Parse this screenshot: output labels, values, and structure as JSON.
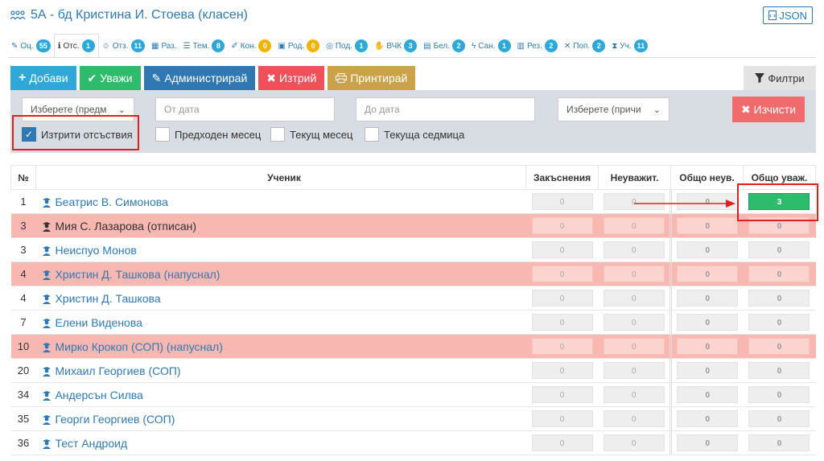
{
  "header": {
    "title": "5А - бд Кристина И. Стоева (класен)",
    "json_label": "JSON"
  },
  "tabs": [
    {
      "label": "Оц.",
      "badge": "55",
      "icon": "pencil-icon",
      "color": "#2fa8d8",
      "active": false
    },
    {
      "label": "Отс.",
      "badge": "1",
      "icon": "info-circle-icon",
      "color": "#2fa8d8",
      "active": true
    },
    {
      "label": "Отз.",
      "badge": "11",
      "icon": "users-icon",
      "color": "#2fa8d8",
      "active": false
    },
    {
      "label": "Раз.",
      "badge": "",
      "icon": "table-icon",
      "color": "#2fa8d8",
      "active": false
    },
    {
      "label": "Тем.",
      "badge": "8",
      "icon": "list-icon",
      "color": "#2fa8d8",
      "active": false
    },
    {
      "label": "Кон.",
      "badge": "0",
      "icon": "edit-icon",
      "color": "#f0b400",
      "active": false
    },
    {
      "label": "Род.",
      "badge": "0",
      "icon": "calendar-icon",
      "color": "#f0b400",
      "active": false
    },
    {
      "label": "Под.",
      "badge": "1",
      "icon": "eye-icon",
      "color": "#2fa8d8",
      "active": false
    },
    {
      "label": "ВЧК",
      "badge": "3",
      "icon": "handshake-icon",
      "color": "#2fa8d8",
      "active": false
    },
    {
      "label": "Бел.",
      "badge": "2",
      "icon": "note-icon",
      "color": "#2fa8d8",
      "active": false
    },
    {
      "label": "Сан.",
      "badge": "1",
      "icon": "bolt-icon",
      "color": "#2fa8d8",
      "active": false
    },
    {
      "label": "Рез.",
      "badge": "2",
      "icon": "doc-icon",
      "color": "#2fa8d8",
      "active": false
    },
    {
      "label": "Поп.",
      "badge": "2",
      "icon": "tools-icon",
      "color": "#2fa8d8",
      "active": false
    },
    {
      "label": "Уч.",
      "badge": "11",
      "icon": "hourglass-icon",
      "color": "#2fa8d8",
      "active": false
    }
  ],
  "actions": {
    "add": "Добави",
    "excuse": "Уважи",
    "administer": "Администрирай",
    "delete": "Изтрий",
    "print": "Принтирай",
    "filters": "Филтри"
  },
  "filters": {
    "subject_select": "Изберете (предм",
    "from_date_placeholder": "От дата",
    "to_date_placeholder": "До дата",
    "reason_select": "Изберете (причи",
    "clear": "Изчисти",
    "deleted_label": "Изтрити отсъствия",
    "prev_month_label": "Предходен месец",
    "current_month_label": "Текущ месец",
    "current_week_label": "Текуща седмица"
  },
  "table": {
    "headers": [
      "№",
      "Ученик",
      "Закъснения",
      "Неуважит.",
      "Общо неув.",
      "Общо уваж."
    ],
    "rows": [
      {
        "num": "1",
        "name": "Беатрис В. Симонова",
        "late": "0",
        "unexc": "0",
        "total_unexc": "0",
        "total_exc": "3",
        "pink": false
      },
      {
        "num": "3",
        "name": "Мия С. Лазарова (отписан)",
        "late": "0",
        "unexc": "0",
        "total_unexc": "0",
        "total_exc": "0",
        "pink": true
      },
      {
        "num": "3",
        "name": "Неиспуо Монов",
        "late": "0",
        "unexc": "0",
        "total_unexc": "0",
        "total_exc": "0",
        "pink": false
      },
      {
        "num": "4",
        "name": "Христин Д. Ташкова (напуснал)",
        "late": "0",
        "unexc": "0",
        "total_unexc": "0",
        "total_exc": "0",
        "pink": true
      },
      {
        "num": "4",
        "name": "Христин Д. Ташкова",
        "late": "0",
        "unexc": "0",
        "total_unexc": "0",
        "total_exc": "0",
        "pink": false
      },
      {
        "num": "7",
        "name": "Елени Виденова",
        "late": "0",
        "unexc": "0",
        "total_unexc": "0",
        "total_exc": "0",
        "pink": false
      },
      {
        "num": "10",
        "name": "Мирко Крокоп (СОП) (напуснал)",
        "late": "0",
        "unexc": "0",
        "total_unexc": "0",
        "total_exc": "0",
        "pink": true
      },
      {
        "num": "20",
        "name": "Михаил Георгиев (СОП)",
        "late": "0",
        "unexc": "0",
        "total_unexc": "0",
        "total_exc": "0",
        "pink": false
      },
      {
        "num": "34",
        "name": "Андерсън Силва",
        "late": "0",
        "unexc": "0",
        "total_unexc": "0",
        "total_exc": "0",
        "pink": false
      },
      {
        "num": "35",
        "name": "Георги Георгиев (СОП)",
        "late": "0",
        "unexc": "0",
        "total_unexc": "0",
        "total_exc": "0",
        "pink": false
      },
      {
        "num": "36",
        "name": "Тест Андроид",
        "late": "0",
        "unexc": "0",
        "total_unexc": "0",
        "total_exc": "0",
        "pink": false
      }
    ]
  },
  "colors": {
    "add": "#2fa8d8",
    "excuse": "#2ebb6b",
    "administer": "#2f78b4",
    "delete": "#f0505a",
    "print": "#c9a24a",
    "clear": "#f06b6b",
    "highlight": "#e0201e",
    "pink_row": "#f8b7b0"
  }
}
